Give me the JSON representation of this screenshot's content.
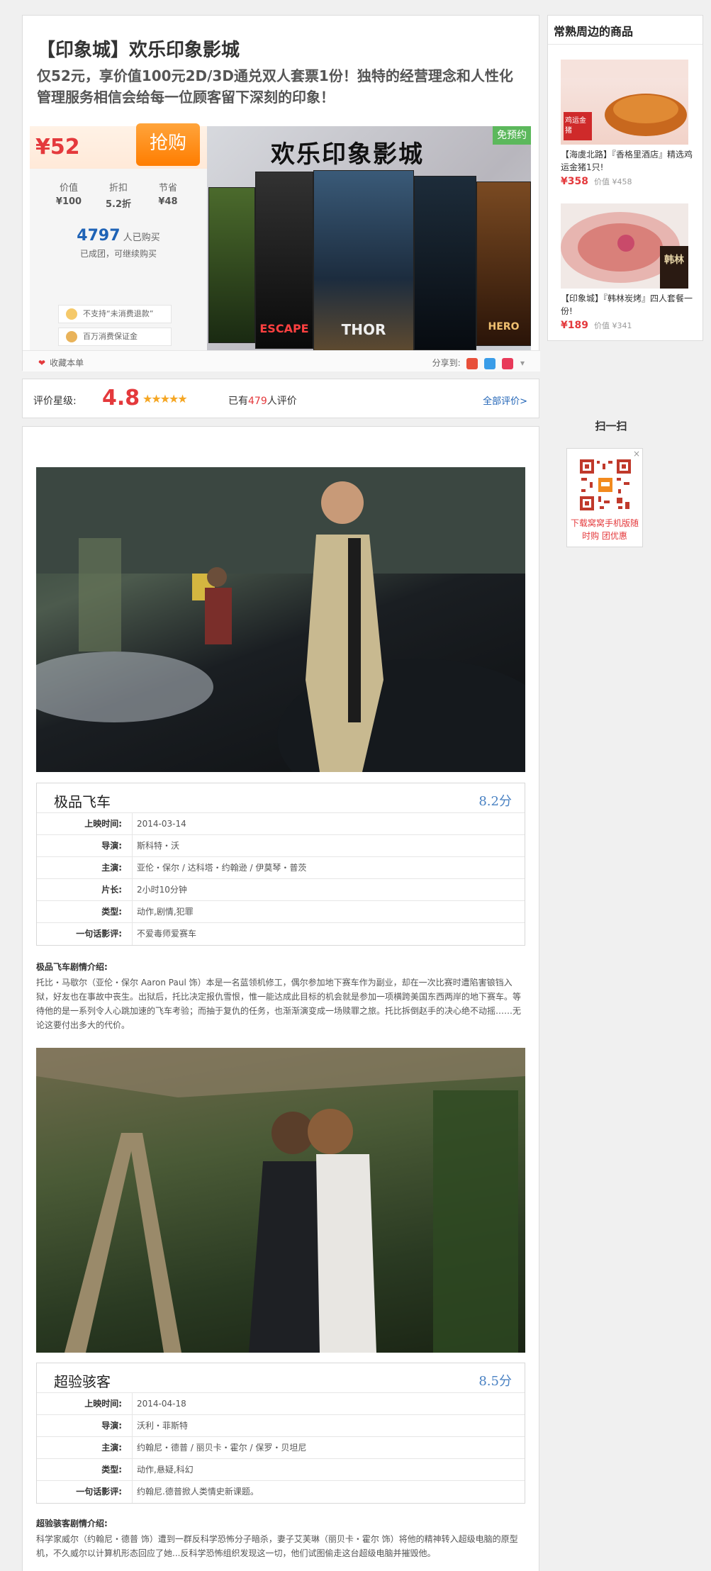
{
  "deal": {
    "title": "【印象城】欢乐印象影城",
    "subtitle": "仅52元，享价值100元2D/3D通兑双人套票1份！独特的经营理念和人性化管理服务相信会给每一位顾客留下深刻的印象！",
    "price": "¥52",
    "buy_label": "抢购",
    "stats": [
      {
        "label": "价值",
        "value": "¥100"
      },
      {
        "label": "折扣",
        "value": "5.2折"
      },
      {
        "label": "节省",
        "value": "¥48"
      }
    ],
    "bought_count": "4797",
    "bought_suffix": "人已购买",
    "bought_note": "已成团，可继续购买",
    "guarantees": [
      "不支持“未消费退款”",
      "百万消费保证金"
    ],
    "banner_title": "欢乐印象影城",
    "free_tag": "免预约",
    "favorite_label": "收藏本单",
    "share_label": "分享到:",
    "posters": [
      "ESCAPE",
      "THOR",
      "HERO"
    ],
    "colors": {
      "accent": "#e4393c",
      "buy": "#ff8a00",
      "link": "#1f63b6",
      "free": "#5cb85c"
    }
  },
  "rating": {
    "label": "评价星级:",
    "value": "4.8",
    "stars": "★★★★★",
    "count_prefix": "已有",
    "count": "479",
    "count_suffix": "人评价",
    "all_link": "全部评价>"
  },
  "movies": [
    {
      "name": "极品飞车",
      "score": "8.2分",
      "rows": [
        {
          "k": "上映时间:",
          "v": "2014-03-14"
        },
        {
          "k": "导演:",
          "v": "斯科特・沃"
        },
        {
          "k": "主演:",
          "v": "亚伦・保尔 / 达科塔・约翰逊 / 伊莫琴・普茨"
        },
        {
          "k": "片长:",
          "v": "2小时10分钟"
        },
        {
          "k": "类型:",
          "v": "动作,剧情,犯罪"
        },
        {
          "k": "一句话影评:",
          "v": "不爱毒师爱赛车"
        }
      ],
      "synopsis_title": "极品飞车剧情介绍:",
      "synopsis": "托比・马歇尔（亚伦・保尔 Aaron Paul 饰）本是一名蓝领机修工，偶尔参加地下赛车作为副业，却在一次比赛时遭陷害锒铛入狱，好友也在事故中丧生。出狱后，托比决定报仇雪恨，惟一能达成此目标的机会就是参加一项横跨美国东西两岸的地下赛车。等待他的是一系列令人心跳加速的飞车考验；而抽于复仇的任务，也渐渐演变成一场赎罪之旅。托比拆倒赵手的决心绝不动摇……无论这要付出多大的代价。"
    },
    {
      "name": "超验骇客",
      "score": "8.5分",
      "rows": [
        {
          "k": "上映时间:",
          "v": "2014-04-18"
        },
        {
          "k": "导演:",
          "v": "沃利・菲斯特"
        },
        {
          "k": "主演:",
          "v": "约翰尼・德普 / 丽贝卡・霍尔 / 保罗・贝坦尼"
        },
        {
          "k": "类型:",
          "v": "动作,悬疑,科幻"
        },
        {
          "k": "一句话影评:",
          "v": "约翰尼.德普掀人类情史新课题。"
        }
      ],
      "synopsis_title": "超验骇客剧情介绍:",
      "synopsis": "科学家威尔（约翰尼・德普 饰）遭到一群反科学恐怖分子暗杀，妻子艾芙琳（丽贝卡・霍尔 饰）将他的精神转入超级电脑的原型机，不久威尔以计算机形态回应了她...反科学恐怖组织发现这一切，他们试图偷走这台超级电脑并摧毁他。"
    }
  ],
  "sidebar": {
    "title": "常熟周边的商品",
    "items": [
      {
        "name": "【海虞北路】『香格里酒店』精选鸡运金猪1只!",
        "price": "¥358",
        "orig": "价值 ¥458",
        "img_text": "鸡运金猪"
      },
      {
        "name": "【印象城】『韩林炭烤』四人套餐一份!",
        "price": "¥189",
        "orig": "价值 ¥341",
        "img_text": "韩林"
      }
    ],
    "scan_label": "扫一扫",
    "qr_close": "×",
    "qr_text": "下载窝窝手机版随时购  团优惠"
  }
}
